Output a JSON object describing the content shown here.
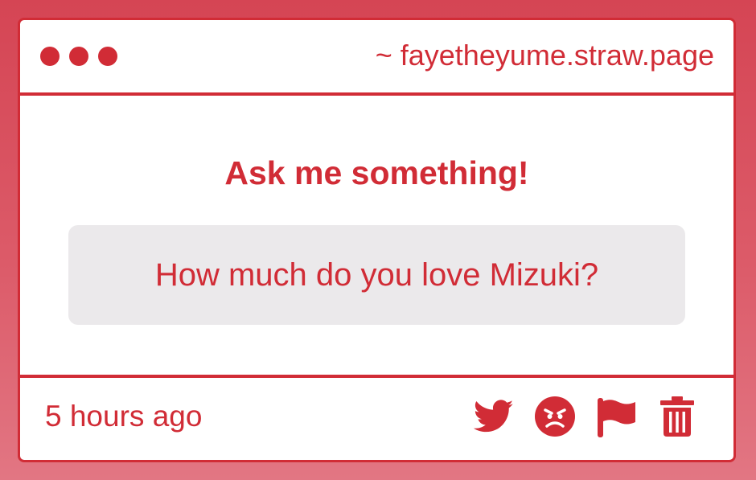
{
  "window": {
    "url": "~ fayetheyume.straw.page"
  },
  "main": {
    "heading": "Ask me something!",
    "question": "How much do you love Mizuki?"
  },
  "footer": {
    "timestamp": "5 hours ago",
    "actions": [
      "twitter-icon",
      "angry-face-icon",
      "flag-icon",
      "trash-icon"
    ]
  },
  "colors": {
    "accent": "#d12c36",
    "background_top": "#d54554",
    "background_bottom": "#e27683",
    "question_box": "#ebe9eb",
    "card": "#ffffff"
  }
}
